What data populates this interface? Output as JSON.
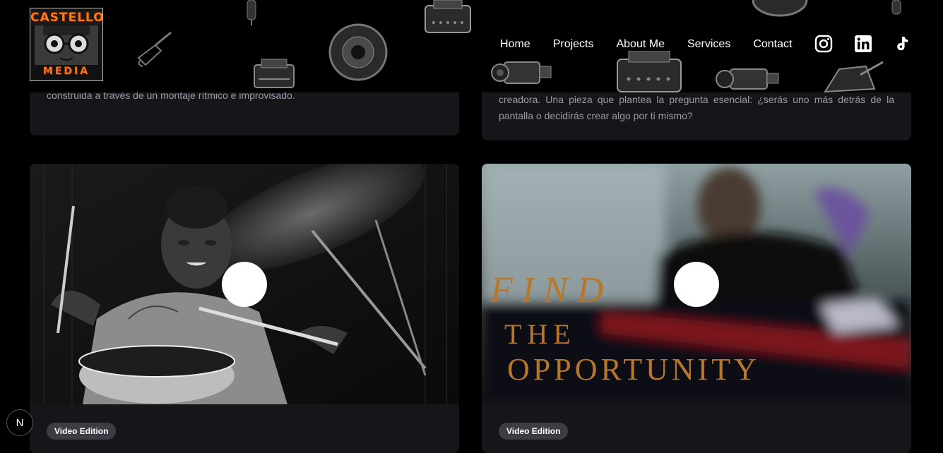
{
  "header": {
    "logo": {
      "line1": "CASTELLO",
      "line2": "MEDIA"
    },
    "nav": [
      "Home",
      "Projects",
      "About Me",
      "Services",
      "Contact"
    ],
    "social": [
      {
        "icon": "instagram-icon"
      },
      {
        "icon": "linkedin-icon"
      },
      {
        "icon": "tiktok-icon"
      }
    ]
  },
  "cards_top": [
    {
      "text": "construida a través de un montaje rítmico e improvisado."
    },
    {
      "text": "creadora. Una pieza que plantea la pregunta esencial: ¿serás uno más detrás de la pantalla o decidirás crear algo por ti mismo?"
    }
  ],
  "cards": [
    {
      "badge": "Video Edition",
      "thumbnail": "drummer-thumbnail"
    },
    {
      "badge": "Video Edition",
      "thumbnail": "find-the-opportunity-thumbnail",
      "overlay": {
        "line1": "FIND",
        "line2": "THE",
        "line3": "OPPORTUNITY"
      }
    }
  ],
  "floating_button": {
    "label": "N"
  },
  "colors": {
    "background": "#000000",
    "card": "#16161a",
    "badge": "#3c3c44",
    "overlay_text": "#b6772a"
  }
}
